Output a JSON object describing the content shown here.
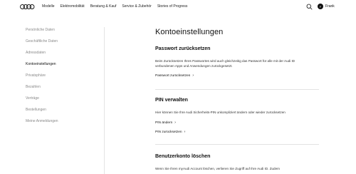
{
  "header": {
    "nav": [
      "Modelle",
      "Elektromobilität",
      "Beratung & Kauf",
      "Service & Zubehör",
      "Stories of Progress"
    ],
    "user": {
      "initial": "F",
      "name": "Frank"
    }
  },
  "sidebar": {
    "items": [
      {
        "label": "Persönliche Daten"
      },
      {
        "label": "Geschäftliche Daten"
      },
      {
        "label": "Adressdaten"
      },
      {
        "label": "Kontoeinstellungen"
      },
      {
        "label": "Privatsphäre"
      },
      {
        "label": "Bezahlen"
      },
      {
        "label": "Verträge"
      },
      {
        "label": "Bestellungen"
      },
      {
        "label": "Meine Anmeldungen"
      }
    ],
    "active_index": 3
  },
  "main": {
    "title": "Kontoeinstellungen",
    "password": {
      "heading": "Passwort zurücksetzen",
      "text": "Beim Zurücksetzen Ihres Passwortes wird auch gleichzeitig das Passwort für alle mit der Audi ID verbundenen Apps und Anwendungen zurückgesetzt.",
      "link": "Passwort zurücksetzen"
    },
    "pin": {
      "heading": "PIN verwalten",
      "text": "Hier können Sie Ihre Audi Sicherheits-PIN unkompliziert ändern oder wieder zurücksetzen",
      "link_change": "PIN ändern",
      "link_reset": "PIN zurücksetzen"
    },
    "delete": {
      "heading": "Benutzerkonto löschen",
      "text": "Wenn Sie Ihren myAudi Account löschen, verlieren Sie Zugriff auf Ihre Audi ID. Zudem"
    }
  },
  "chevron": "›"
}
